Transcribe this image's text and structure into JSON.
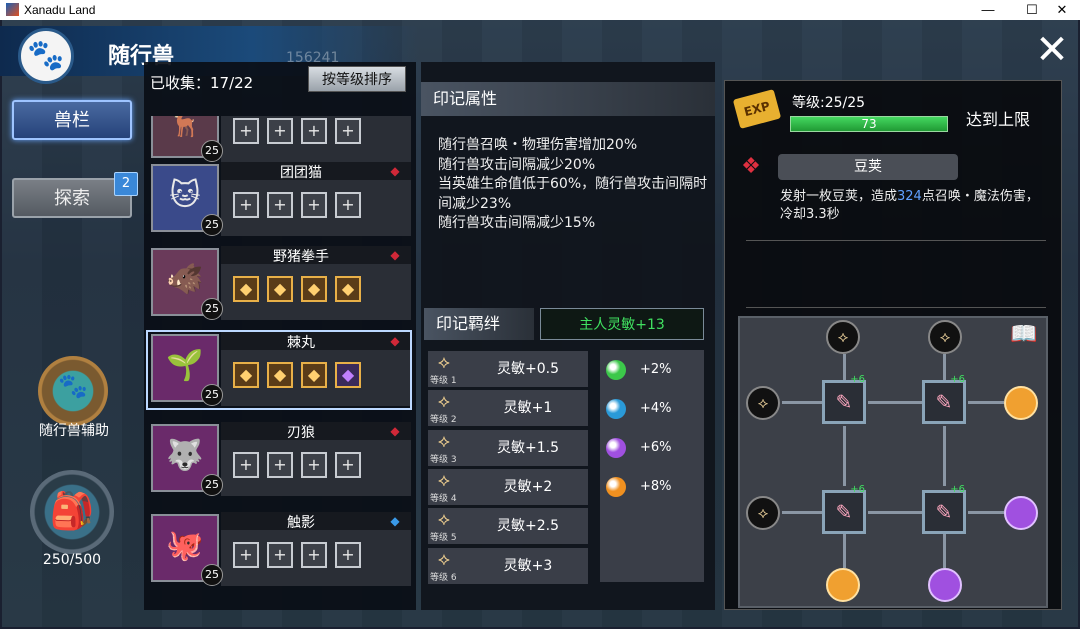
{
  "window": {
    "title": "Xanadu Land",
    "minimize": "—",
    "maximize": "☐",
    "close": "✕"
  },
  "header": {
    "title": "随行兽",
    "bg_counter": "156241"
  },
  "sidebar": {
    "tabs": [
      {
        "label": "兽栏",
        "active": true
      },
      {
        "label": "探索",
        "badge": "2"
      }
    ],
    "assist_label": "随行兽辅助",
    "bag_count": "250/500"
  },
  "list": {
    "collected": "已收集：17/22",
    "sort_label": "按等级排序",
    "pets": [
      {
        "name": "",
        "level": "25",
        "element": "fire",
        "portrait": "🦌",
        "slots": [
          "+",
          "+",
          "+",
          "+"
        ]
      },
      {
        "name": "团团猫",
        "level": "25",
        "element": "fire",
        "portrait": "🐱",
        "slots": [
          "+",
          "+",
          "+",
          "+"
        ]
      },
      {
        "name": "野猪拳手",
        "level": "25",
        "element": "fire",
        "portrait": "🐗",
        "slots": [
          "◆",
          "◆",
          "◆",
          "◆"
        ]
      },
      {
        "name": "棘丸",
        "level": "25",
        "element": "fire",
        "portrait": "🌱",
        "slots": [
          "◆",
          "◆",
          "◆",
          "◆"
        ],
        "selected": true
      },
      {
        "name": "刃狼",
        "level": "25",
        "element": "fire",
        "portrait": "🐺",
        "slots": [
          "+",
          "+",
          "+",
          "+"
        ]
      },
      {
        "name": "触影",
        "level": "25",
        "element": "water",
        "portrait": "🐙",
        "slots": [
          "+",
          "+",
          "+",
          "+"
        ]
      }
    ]
  },
  "imprint": {
    "header": "印记属性",
    "effects": [
      "随行兽召唤・物理伤害增加20%",
      "随行兽攻击间隔减少20%",
      "当英雄生命值低于60%，随行兽攻击间隔时间减少23%",
      "随行兽攻击间隔减少15%"
    ],
    "bond_header": "印记羁绊",
    "bond_value": "主人灵敏+13",
    "level_prefix": "等级",
    "bond_levels": [
      {
        "level": "1",
        "value": "灵敏+0.5"
      },
      {
        "level": "2",
        "value": "灵敏+1"
      },
      {
        "level": "3",
        "value": "灵敏+1.5"
      },
      {
        "level": "4",
        "value": "灵敏+2"
      },
      {
        "level": "5",
        "value": "灵敏+2.5"
      },
      {
        "level": "6",
        "value": "灵敏+3"
      }
    ],
    "gems": [
      {
        "color": "#3cc84a",
        "value": "+2%"
      },
      {
        "color": "#2a9ad8",
        "value": "+4%"
      },
      {
        "color": "#a050e0",
        "value": "+6%"
      },
      {
        "color": "#f09020",
        "value": "+8%"
      }
    ]
  },
  "detail": {
    "exp_icon": "EXP",
    "level_text": "等级:25/25",
    "exp_value": "73",
    "exp_fill": 1.0,
    "max_text": "达到上限",
    "skill_name": "豆荚",
    "skill_desc_pre": "发射一枚豆荚，造成",
    "skill_desc_num": "324",
    "skill_desc_post": "点召唤・魔法伤害，冷却3.3秒",
    "tree_plus": "+6"
  },
  "colors": {
    "accent": "#1b4a7a",
    "exp_green": "#209a34",
    "bond_green": "#40e060"
  }
}
